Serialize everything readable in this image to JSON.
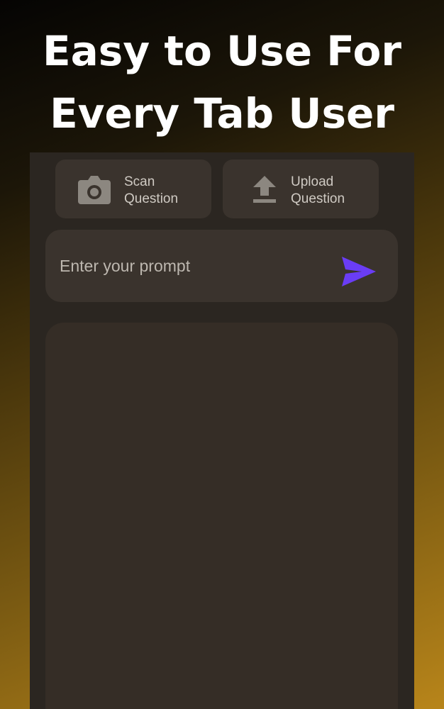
{
  "headline": {
    "line1": "Easy to Use For",
    "line2": "Every Tab User"
  },
  "actions": {
    "scan": {
      "line1": "Scan",
      "line2": "Question",
      "icon": "camera-icon"
    },
    "upload": {
      "line1": "Upload",
      "line2": "Question",
      "icon": "upload-icon"
    }
  },
  "prompt": {
    "placeholder": "Enter your prompt",
    "send_icon": "send-icon"
  },
  "colors": {
    "accent": "#6a3df5",
    "panel": "#3a332d",
    "background": "#2b2621"
  }
}
